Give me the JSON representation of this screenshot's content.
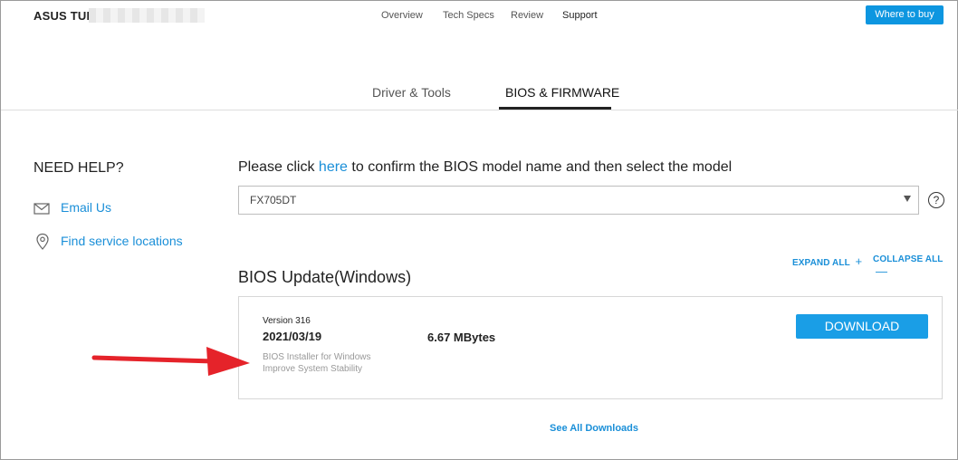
{
  "header": {
    "brand": "ASUS TUF",
    "nav": [
      "Overview",
      "Tech Specs",
      "Review",
      "Support"
    ],
    "buy_label": "Where to buy"
  },
  "tabs": [
    {
      "label": "Driver & Tools",
      "active": false
    },
    {
      "label": "BIOS & FIRMWARE",
      "active": true
    }
  ],
  "help": {
    "title": "NEED HELP?",
    "email_label": "Email Us",
    "locations_label": "Find service locations"
  },
  "main": {
    "prompt_before": "Please click ",
    "prompt_link": "here",
    "prompt_after": " to confirm the BIOS model name and then select the model",
    "model_selected": "FX705DT",
    "help_glyph": "?",
    "expand_all": "EXPAND ALL",
    "collapse_all": "COLLAPSE ALL",
    "section_title": "BIOS Update(Windows)",
    "item": {
      "version": "Version 316",
      "date": "2021/03/19",
      "size": "6.67 MBytes",
      "desc_line1": "BIOS Installer for Windows",
      "desc_line2": "Improve System Stability",
      "download_label": "DOWNLOAD"
    },
    "see_all": "See All Downloads"
  },
  "colors": {
    "accent": "#1a8fd8",
    "button": "#1a9ee6",
    "arrow": "#e5232a"
  }
}
